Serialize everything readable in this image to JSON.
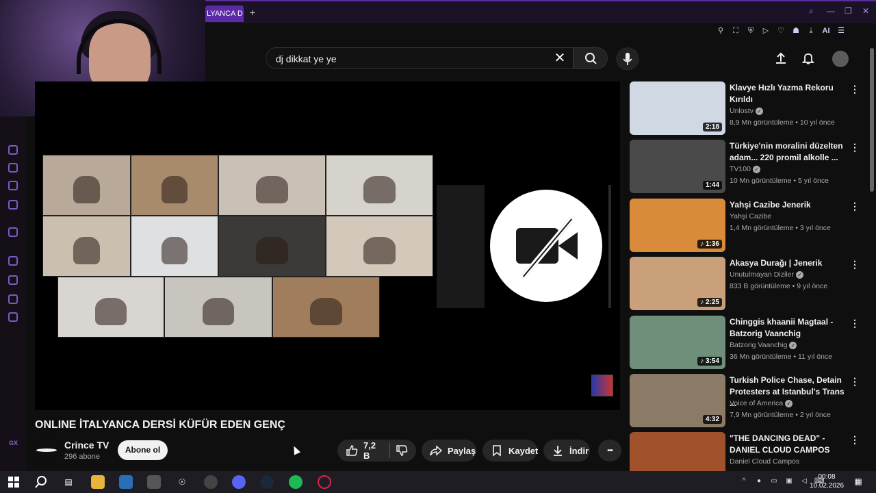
{
  "browser": {
    "tab_title": "LYANCA D",
    "new_tab": "+",
    "ai_label": "AI"
  },
  "header": {
    "search_value": "dj dikkat ye ye",
    "clear_glyph": "✕",
    "search_glyph": "⚲",
    "mic_glyph": "🎙",
    "upload_glyph": "⇧",
    "bell_glyph": "🔔"
  },
  "video": {
    "title": "ONLINE İTALYANCA DERSİ KÜFÜR EDEN GENÇ",
    "channel": "Crince TV",
    "subscribers": "296 abone",
    "subscribe_label": "Abone ol",
    "likes": "7,2 B",
    "share_label": "Paylaş",
    "save_label": "Kaydet",
    "download_label": "İndir",
    "more_glyph": "•••"
  },
  "recommendations": [
    {
      "title": "Klavye Hızlı Yazma Rekoru Kırıldı",
      "channel": "Unlostv",
      "verified": true,
      "views": "8,9 Mn görüntüleme",
      "age": "10 yıl önce",
      "duration": "2:18",
      "thumb_color": "#cfd8e3"
    },
    {
      "title": "Türkiye'nin moralini düzelten adam... 220 promil alkolle ...",
      "channel": "TV100",
      "verified": true,
      "views": "10 Mn görüntüleme",
      "age": "5 yıl önce",
      "duration": "1:44",
      "thumb_color": "#4a4a4a"
    },
    {
      "title": "Yahşi Cazibe Jenerik",
      "channel": "Yahşi Cazibe",
      "verified": false,
      "views": "1,4 Mn görüntüleme",
      "age": "3 yıl önce",
      "duration": "♪ 1:36",
      "thumb_color": "#d98a3a"
    },
    {
      "title": "Akasya Durağı | Jenerik",
      "channel": "Unutulmayan Diziler",
      "verified": true,
      "views": "833 B görüntüleme",
      "age": "9 yıl önce",
      "duration": "♪ 2:25",
      "thumb_color": "#c9a07a"
    },
    {
      "title": "Chinggis khaanii Magtaal - Batzorig Vaanchig",
      "channel": "Batzorig Vaanchig",
      "verified": true,
      "views": "36 Mn görüntüleme",
      "age": "11 yıl önce",
      "duration": "♪ 3:54",
      "thumb_color": "#6f8f7a"
    },
    {
      "title": "Turkish Police Chase, Detain Protesters at Istanbul's Trans ...",
      "channel": "Voice of America",
      "verified": true,
      "views": "7,9 Mn görüntüleme",
      "age": "2 yıl önce",
      "duration": "4:32",
      "thumb_color": "#8a7a66"
    },
    {
      "title": "\"THE DANCING DEAD\" - DANIEL CLOUD CAMPOS",
      "channel": "Daniel Cloud Campos",
      "verified": false,
      "views": "",
      "age": "",
      "duration": "",
      "thumb_color": "#a0522d"
    }
  ],
  "taskbar": {
    "time": "00:08",
    "date": "10.02.2026"
  },
  "sidebar": {
    "gx_label": "GX"
  }
}
